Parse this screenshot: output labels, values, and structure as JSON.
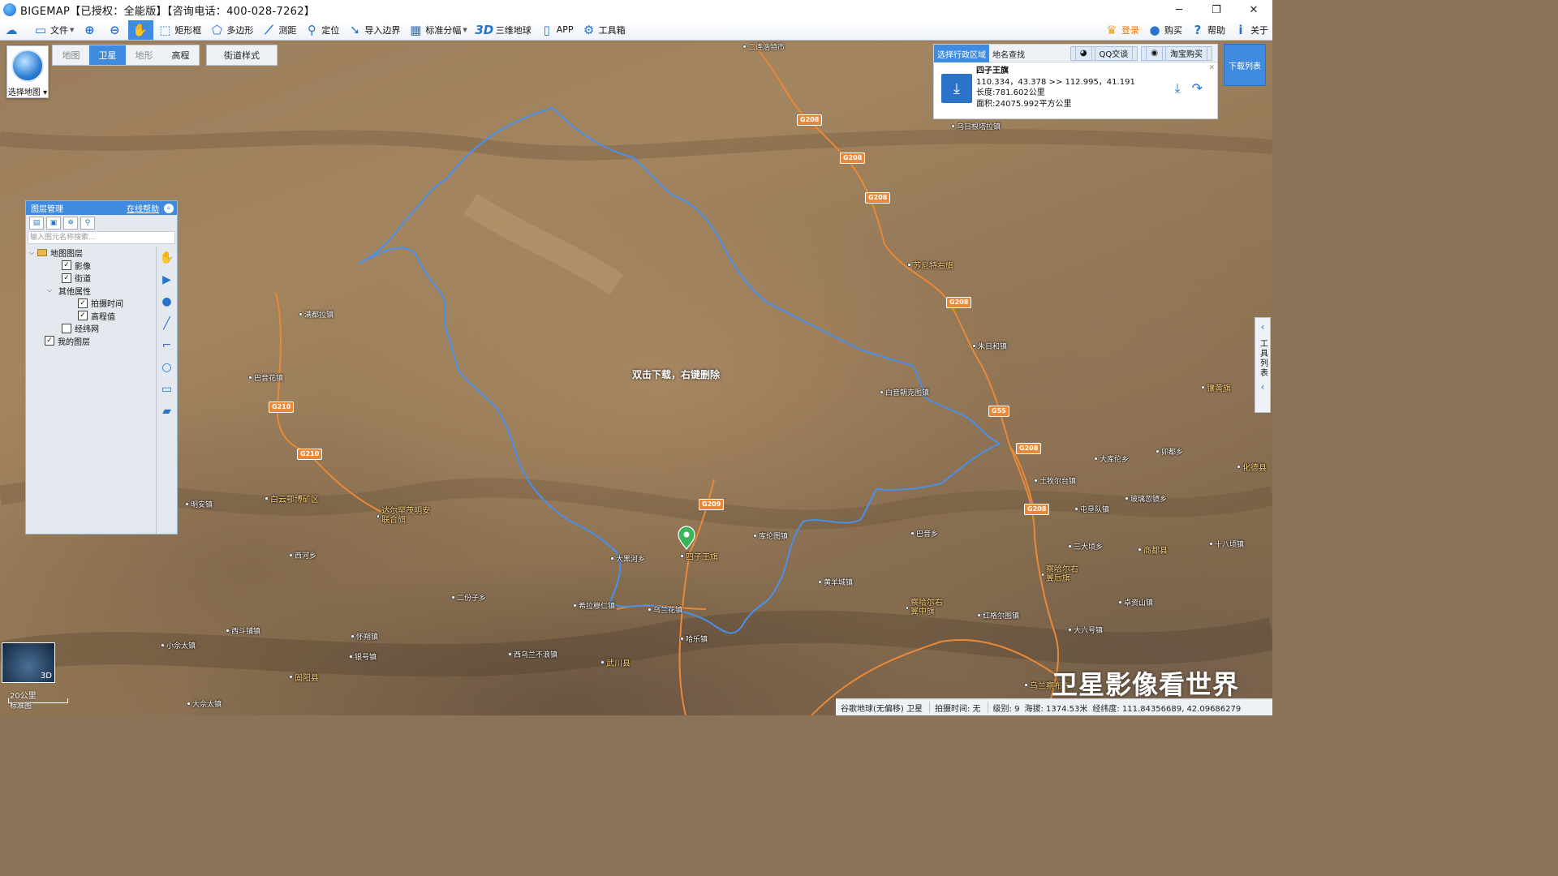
{
  "titlebar": {
    "title": "BIGEMAP【已授权：全能版】【咨询电话：400-028-7262】",
    "minimize": "─",
    "maximize": "❐",
    "close": "✕"
  },
  "toolbar": {
    "items": [
      {
        "label": "文件",
        "icon": "file-icon"
      },
      {
        "label": "",
        "icon": "zoom-in-icon"
      },
      {
        "label": "",
        "icon": "zoom-out-icon"
      },
      {
        "label": "",
        "icon": "pan-hand-icon"
      },
      {
        "label": "矩形框",
        "icon": "rectangle-icon"
      },
      {
        "label": "多边形",
        "icon": "polygon-icon"
      },
      {
        "label": "测距",
        "icon": "ruler-icon"
      },
      {
        "label": "定位",
        "icon": "location-pin-icon"
      },
      {
        "label": "导入边界",
        "icon": "import-icon"
      },
      {
        "label": "标准分幅",
        "icon": "grid-icon"
      },
      {
        "label": "三维地球",
        "icon": "3d-icon"
      },
      {
        "label": "APP",
        "icon": "phone-icon"
      },
      {
        "label": "工具箱",
        "icon": "gear-icon"
      }
    ],
    "right": {
      "login": "登录",
      "buy": "购买",
      "help": "帮助",
      "about": "关于"
    }
  },
  "map_controls": {
    "select_map": "选择地图",
    "tabs": [
      "地图",
      "卫星",
      "地形",
      "高程"
    ],
    "active_tab": "卫星",
    "street_style": "街道样式",
    "hint": "双击下载，右键删除"
  },
  "layer_panel": {
    "title": "图层管理",
    "help_link": "在线帮助",
    "search_placeholder": "输入图元名称搜索...",
    "tree": [
      {
        "label": "地图图层",
        "level": 0,
        "expanded": true,
        "folder": true
      },
      {
        "label": "影像",
        "level": 1,
        "checked": true
      },
      {
        "label": "街道",
        "level": 1,
        "checked": true
      },
      {
        "label": "其他属性",
        "level": 1,
        "expanded": true
      },
      {
        "label": "拍摄时间",
        "level": 2,
        "checked": true
      },
      {
        "label": "高程值",
        "level": 2,
        "checked": true
      },
      {
        "label": "经纬网",
        "level": 1,
        "checked": false
      },
      {
        "label": "我的图层",
        "level": 0,
        "checked": true
      }
    ]
  },
  "region_panel": {
    "tab_admin": "选择行政区域",
    "tab_search": "地名查找",
    "qq": "QQ交谈",
    "taobao": "淘宝购买",
    "name": "四子王旗",
    "coords": "110.334，43.378 >> 112.995，41.191",
    "length": "长度:781.602公里",
    "area": "面积:24075.992平方公里"
  },
  "download_list": "下载列表",
  "tool_list": "工具列表",
  "places": [
    {
      "name": "二连浩特市",
      "type": "town"
    },
    {
      "name": "乌日根塔拉镇",
      "type": "town"
    },
    {
      "name": "苏尼特右旗",
      "type": "county"
    },
    {
      "name": "朱日和镇",
      "type": "town"
    },
    {
      "name": "白音朝克图镇",
      "type": "town"
    },
    {
      "name": "满都拉镇",
      "type": "town"
    },
    {
      "name": "巴音花镇",
      "type": "town"
    },
    {
      "name": "白云鄂博矿区",
      "type": "county"
    },
    {
      "name": "达尔罕茂明安联合旗",
      "type": "county"
    },
    {
      "name": "明安镇",
      "type": "town"
    },
    {
      "name": "四子王旗",
      "type": "county"
    },
    {
      "name": "库伦图镇",
      "type": "town"
    },
    {
      "name": "大黑河乡",
      "type": "town"
    },
    {
      "name": "西河乡",
      "type": "town"
    },
    {
      "name": "乌兰花镇",
      "type": "town"
    },
    {
      "name": "镶黄旗",
      "type": "county"
    },
    {
      "name": "化德县",
      "type": "county"
    },
    {
      "name": "商都县",
      "type": "county"
    },
    {
      "name": "察哈尔右翼后旗",
      "type": "county"
    },
    {
      "name": "察哈尔右翼中旗",
      "type": "county"
    },
    {
      "name": "武川县",
      "type": "county"
    },
    {
      "name": "固阳县",
      "type": "county"
    },
    {
      "name": "乌兰察布市",
      "type": "county"
    },
    {
      "name": "哈乐镇",
      "type": "town"
    },
    {
      "name": "二份子乡",
      "type": "town"
    },
    {
      "name": "希拉穆仁镇",
      "type": "town"
    },
    {
      "name": "怀朔镇",
      "type": "town"
    },
    {
      "name": "西斗铺镇",
      "type": "town"
    },
    {
      "name": "小佘太镇",
      "type": "town"
    },
    {
      "name": "银号镇",
      "type": "town"
    },
    {
      "name": "西乌兰不浪镇",
      "type": "town"
    },
    {
      "name": "大佘太镇",
      "type": "town"
    },
    {
      "name": "明安镇",
      "type": "town"
    },
    {
      "name": "黄羊城镇",
      "type": "town"
    },
    {
      "name": "巴音乡",
      "type": "town"
    },
    {
      "name": "大六号镇",
      "type": "town"
    },
    {
      "name": "土牧尔台镇",
      "type": "town"
    },
    {
      "name": "红格尔图镇",
      "type": "town"
    },
    {
      "name": "卯都乡",
      "type": "town"
    },
    {
      "name": "大库伦乡",
      "type": "town"
    },
    {
      "name": "玻璃忽镜乡",
      "type": "town"
    },
    {
      "name": "屯垦队镇",
      "type": "town"
    },
    {
      "name": "三大顷乡",
      "type": "town"
    },
    {
      "name": "十八顷镇",
      "type": "town"
    },
    {
      "name": "卓资山镇",
      "type": "town"
    }
  ],
  "roads": [
    "G208",
    "G208",
    "G208",
    "G208",
    "G208",
    "G208",
    "G55",
    "G210",
    "G210",
    "G209"
  ],
  "minimap": {
    "label": "3D"
  },
  "scale": {
    "value": "20公里",
    "mode": "标准图"
  },
  "watermark": "卫星影像看世界",
  "status": {
    "source": "谷歌地球(无偏移) 卫星",
    "shoot_time": "拍摄时间: 无",
    "level": "级别:  9",
    "altitude": "海拔: 1374.53米",
    "lnglat": "经纬度: 111.84356689, 42.09686279"
  },
  "colors": {
    "accent": "#3f8be0",
    "boundary": "#4a8fe8",
    "road": "#e8893a",
    "marker": "#3cb45a"
  }
}
